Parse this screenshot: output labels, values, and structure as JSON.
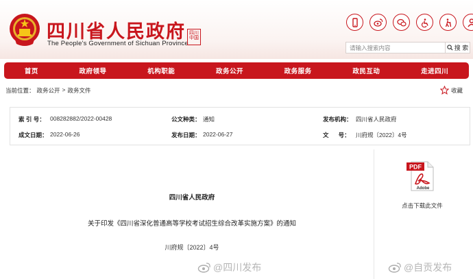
{
  "header": {
    "title": "四川省人民政府",
    "subtitle": "The People's Government of Sichuan Province",
    "seal_text": "四川·中国",
    "tool_icons": [
      "mobile-icon",
      "weibo-icon",
      "wechat-icon",
      "accessibility-icon",
      "elder-care-icon",
      "user-icon"
    ]
  },
  "search": {
    "placeholder": "请输入搜索内容",
    "button_label": "搜 索"
  },
  "nav": {
    "items": [
      {
        "label": "首页"
      },
      {
        "label": "政府领导"
      },
      {
        "label": "机构职能"
      },
      {
        "label": "政务公开"
      },
      {
        "label": "政务服务"
      },
      {
        "label": "政民互动"
      },
      {
        "label": "走进四川"
      }
    ]
  },
  "breadcrumb": {
    "prefix": "当前位置：",
    "items": [
      "政务公开",
      "政务文件"
    ],
    "separator": ">"
  },
  "favorite": {
    "label": "收藏"
  },
  "meta": {
    "index_key": "索 引 号：",
    "index_value": "008282882/2022-00428",
    "category_key": "公文种类：",
    "category_value": "通知",
    "issuer_key": "发布机构：",
    "issuer_value": "四川省人民政府",
    "created_key": "成文日期：",
    "created_value": "2022-06-26",
    "published_key": "发布日期：",
    "published_value": "2022-06-27",
    "docno_key": "文      号：",
    "docno_value": "川府规〔2022〕4号"
  },
  "document": {
    "issuer": "四川省人民政府",
    "title": "关于印发《四川省深化普通高等学校考试招生综合改革实施方案》的通知",
    "number": "川府规〔2022〕4号"
  },
  "download": {
    "pdf_label": "PDF",
    "pdf_brand": "Adobe",
    "label": "点击下载此文件"
  },
  "watermarks": [
    {
      "text": "@四川发布"
    },
    {
      "text": "@自贡发布"
    }
  ],
  "colors": {
    "brand_red": "#c8161d",
    "nav_text": "#ffffff"
  }
}
